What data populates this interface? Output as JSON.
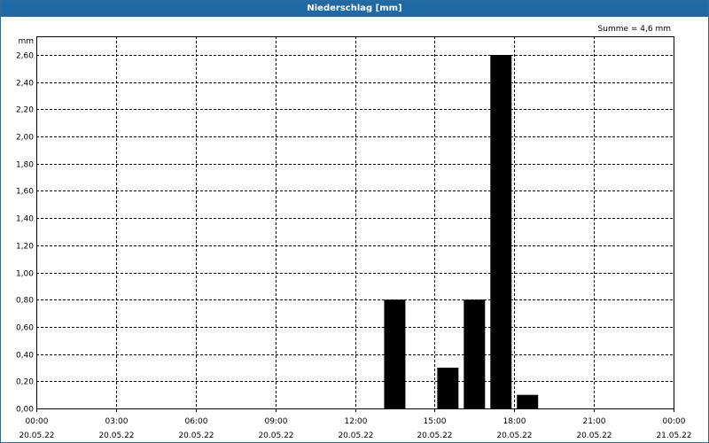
{
  "window": {
    "title": "Niederschlag [mm]"
  },
  "chart_data": {
    "type": "bar",
    "title": "Niederschlag [mm]",
    "unit_label": "mm",
    "sum_label": "Summe = 4,6 mm",
    "ylim": [
      0,
      2.6
    ],
    "y_ticks": [
      0,
      0.2,
      0.4,
      0.6,
      0.8,
      1.0,
      1.2,
      1.4,
      1.6,
      1.8,
      2.0,
      2.2,
      2.4,
      2.6
    ],
    "y_tick_labels": [
      "0,00",
      "0,20",
      "0,40",
      "0,60",
      "0,80",
      "1,00",
      "1,20",
      "1,40",
      "1,60",
      "1,80",
      "2,00",
      "2,20",
      "2,40",
      "2,60"
    ],
    "x_ticks": [
      {
        "time": "00:00",
        "date": "20.05.22"
      },
      {
        "time": "03:00",
        "date": "20.05.22"
      },
      {
        "time": "06:00",
        "date": "20.05.22"
      },
      {
        "time": "09:00",
        "date": "20.05.22"
      },
      {
        "time": "12:00",
        "date": "20.05.22"
      },
      {
        "time": "15:00",
        "date": "20.05.22"
      },
      {
        "time": "18:00",
        "date": "20.05.22"
      },
      {
        "time": "21:00",
        "date": "20.05.22"
      },
      {
        "time": "00:00",
        "date": "21.05.22"
      }
    ],
    "bar_interval_hours": 1,
    "bars": [
      {
        "start": "20.05.22 13:00",
        "end": "20.05.22 14:00",
        "value": 0.8
      },
      {
        "start": "20.05.22 15:00",
        "end": "20.05.22 16:00",
        "value": 0.3
      },
      {
        "start": "20.05.22 16:00",
        "end": "20.05.22 17:00",
        "value": 0.8
      },
      {
        "start": "20.05.22 17:00",
        "end": "20.05.22 18:00",
        "value": 2.6
      },
      {
        "start": "20.05.22 18:00",
        "end": "20.05.22 19:00",
        "value": 0.1
      }
    ],
    "grid": true,
    "colors": {
      "bar": "#000000",
      "title_bar": "#1f6aa5"
    }
  }
}
